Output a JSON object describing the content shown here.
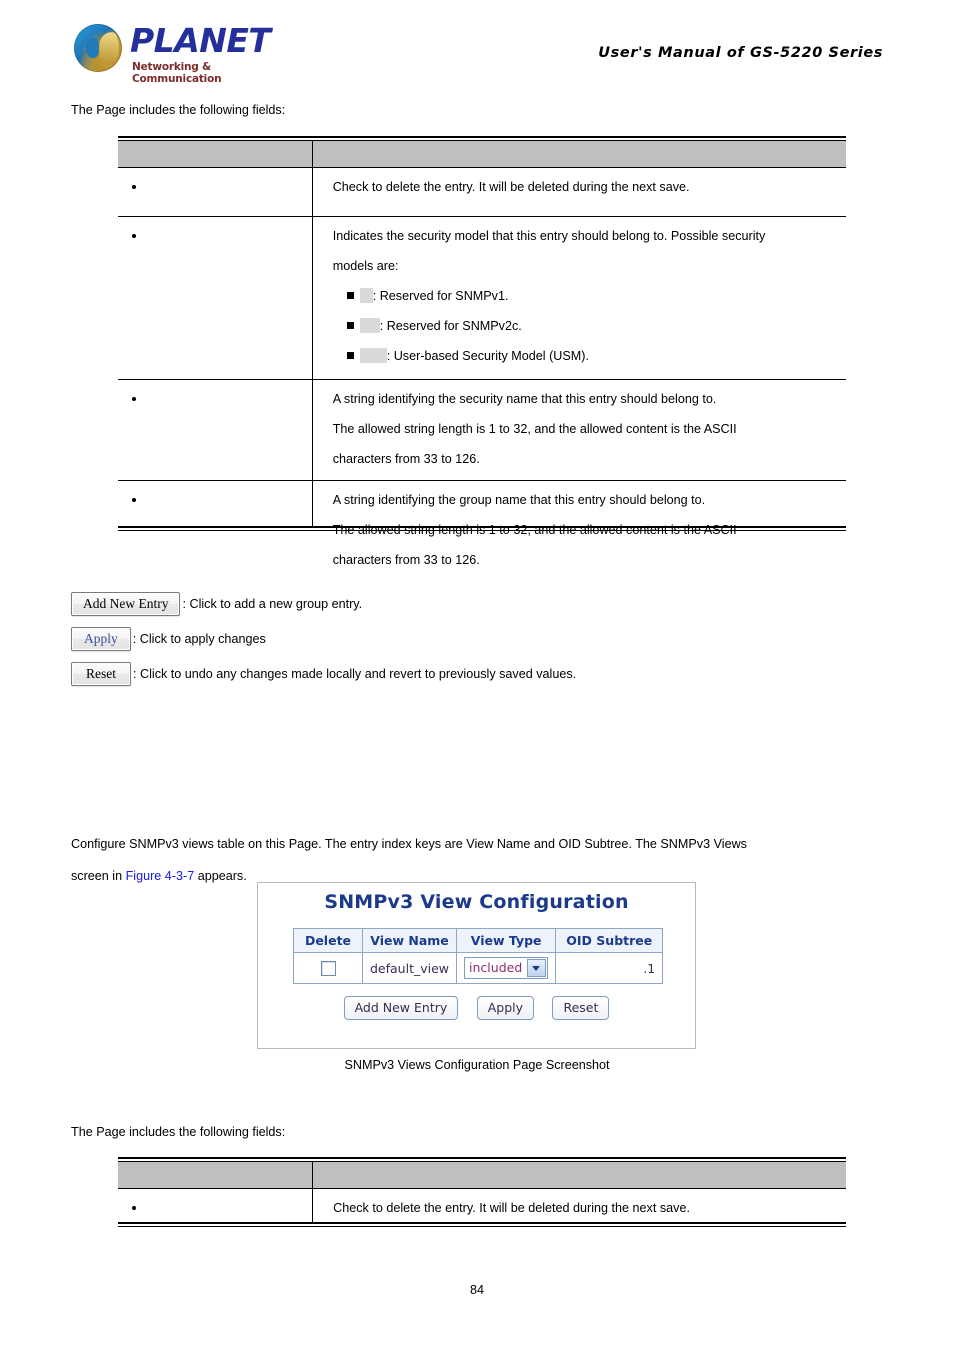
{
  "header": {
    "logo_name": "PLANET",
    "logo_tagline": "Networking & Communication",
    "manual_title": "User's Manual of GS-5220 Series"
  },
  "intro_text_1": "The Page includes the following fields:",
  "intro_text_2": "The Page includes the following fields:",
  "groups_table": {
    "columns": [
      "",
      ""
    ],
    "rows": [
      {
        "object": "",
        "description_lines": [
          "Check to delete the entry. It will be deleted during the next save."
        ],
        "sub_items": []
      },
      {
        "object": "",
        "description_lines": [
          "Indicates the security model that this entry should belong to. Possible security",
          "models are:"
        ],
        "sub_items": [
          {
            "value_redacted": "",
            "text": ": Reserved for SNMPv1."
          },
          {
            "value_redacted": "",
            "text": ": Reserved for SNMPv2c."
          },
          {
            "value_redacted": "",
            "text": ": User-based Security Model (USM)."
          }
        ]
      },
      {
        "object": "",
        "description_lines": [
          "A string identifying the security name that this entry should belong to.",
          "The allowed string length is 1 to 32, and the allowed content is the ASCII",
          "characters from 33 to 126."
        ],
        "sub_items": []
      },
      {
        "object": "",
        "description_lines": [
          "A string identifying the group name that this entry should belong to.",
          "The allowed string length is 1 to 32, and the allowed content is the ASCII",
          "characters from 33 to 126."
        ],
        "sub_items": []
      }
    ]
  },
  "buttons_legend": [
    {
      "button_label": "Add New Entry",
      "description": ": Click to add a new group entry."
    },
    {
      "button_label": "Apply",
      "description": ": Click to apply changes"
    },
    {
      "button_label": "Reset",
      "description": ": Click to undo any changes made locally and revert to previously saved values."
    }
  ],
  "views_paragraph": {
    "line1_before": "Configure SNMPv3 views table on this Page. The entry index keys are View Name and OID Subtree. The SNMPv3 Views",
    "line2_before": "screen in ",
    "figure_link": "Figure 4-3-7",
    "line2_after": " appears."
  },
  "screenshot": {
    "title": "SNMPv3 View Configuration",
    "table": {
      "headers": [
        "Delete",
        "View Name",
        "View Type",
        "OID Subtree"
      ],
      "rows": [
        {
          "delete_checked": false,
          "view_name": "default_view",
          "view_type": "included",
          "oid_subtree": ".1"
        }
      ]
    },
    "buttons": [
      "Add New Entry",
      "Apply",
      "Reset"
    ]
  },
  "caption": "SNMPv3 Views Configuration Page Screenshot",
  "views_fields_table": {
    "columns": [
      "",
      ""
    ],
    "rows": [
      {
        "object": "",
        "description_lines": [
          "Check to delete the entry. It will be deleted during the next save."
        ]
      }
    ]
  },
  "page_number": "84",
  "colors": {
    "brand_blue": "#242f9b",
    "brand_maroon": "#7d2b2b",
    "table_header_gray": "#bfbfbf",
    "redaction_gray": "#d9d9d9",
    "link_blue": "#1a1ae0",
    "ui_title_blue": "#1b3a8c"
  }
}
